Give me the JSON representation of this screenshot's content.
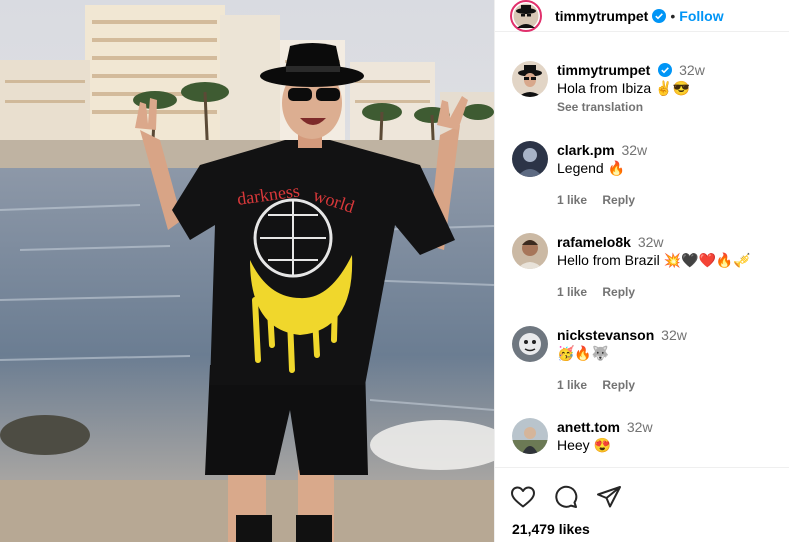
{
  "post": {
    "username": "timmytrumpet",
    "follow_label": "Follow",
    "dot": "•",
    "likes": "21,479 likes"
  },
  "caption": {
    "username": "timmytrumpet",
    "time": "32w",
    "text": "Hola from Ibiza ✌😎",
    "see_translation": "See translation"
  },
  "comments": [
    {
      "username": "clark.pm",
      "time": "32w",
      "text": "Legend 🔥",
      "likes_label": "1 like",
      "reply_label": "Reply"
    },
    {
      "username": "rafamelo8k",
      "time": "32w",
      "text": "Hello from Brazil 💥🖤❤️🔥🎺",
      "likes_label": "1 like",
      "reply_label": "Reply"
    },
    {
      "username": "nickstevanson",
      "time": "32w",
      "text": "🥳🔥🐺",
      "likes_label": "1 like",
      "reply_label": "Reply"
    },
    {
      "username": "anett.tom",
      "time": "32w",
      "text": "Heey 😍"
    }
  ],
  "colors": {
    "accent": "#0095f6",
    "verified": "#0095f6",
    "muted": "#737373"
  },
  "icons": [
    "verified-badge-icon",
    "heart-icon",
    "comment-icon",
    "share-icon"
  ]
}
